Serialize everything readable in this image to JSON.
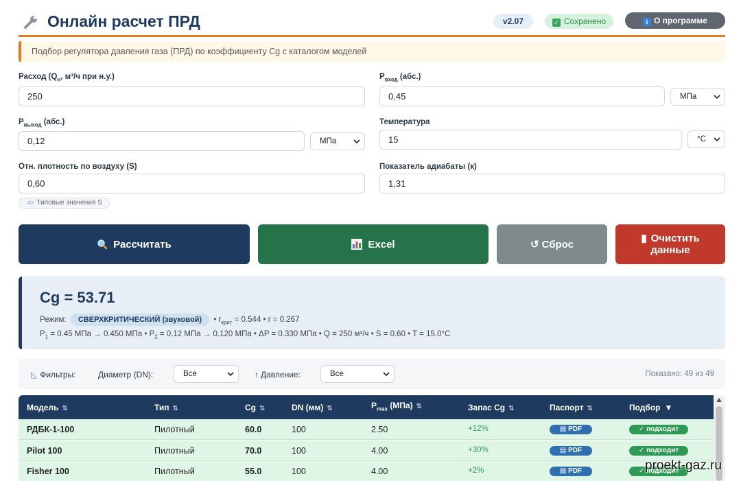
{
  "header": {
    "title": "Онлайн расчет ПРД",
    "version": "v2.07",
    "saved": "Сохранено",
    "about": "О программе"
  },
  "notice": "Подбор регулятора давления газа (ПРД) по коэффициенту Cg с каталогом моделей",
  "form": {
    "flow": {
      "label_pre": "Расход (Q",
      "label_sub": "н",
      "label_post": ", м³/ч при н.у.)",
      "value": "250"
    },
    "p_in": {
      "label_pre": "P",
      "label_sub": "вход",
      "label_post": " (абс.)",
      "value": "0,45",
      "unit": "МПа"
    },
    "p_out": {
      "label_pre": "P",
      "label_sub": "выход",
      "label_post": " (абс.)",
      "value": "0,12",
      "unit": "МПа"
    },
    "temp": {
      "label": "Температура",
      "value": "15",
      "unit": "°C"
    },
    "density": {
      "label": "Отн. плотность по воздуху (S)",
      "value": "0,60"
    },
    "adiabatic": {
      "label": "Показатель адиабаты (к)",
      "value": "1,31"
    },
    "typical_chip": "Типовые значения S"
  },
  "actions": {
    "calc": "Рассчитать",
    "excel": "Excel",
    "reset": "Сброс",
    "clear_line1": "Очистить",
    "clear_line2": "данные"
  },
  "result": {
    "cg": "Cg = 53.71",
    "mode_label": "Режим:",
    "mode_value": "СВЕРХКРИТИЧЕСКИЙ (звуковой)",
    "rcrit_pre": "• r",
    "rcrit_sub": "крит",
    "rcrit_post": " = 0.544 • r = 0.267",
    "p1_pre": "P",
    "p1_sub": "1",
    "p1_post": " = 0.45 МПа → 0.450 МПа • P",
    "p2_sub": "2",
    "p2_post": " = 0.12 МПа → 0.120 МПа • ΔP = 0.330 МПа • Q = 250 м³/ч • S = 0.60 • T = 15.0°C"
  },
  "filters": {
    "label": "Фильтры:",
    "diameter_label": "Диаметр (DN):",
    "diameter_value": "Все",
    "pressure_label": "Давление:",
    "pressure_value": "Все",
    "shown": "Показано: 49 из 49"
  },
  "table": {
    "headers": {
      "model": "Модель",
      "type": "Тип",
      "cg": "Cg",
      "dn": "DN (мм)",
      "pmax_pre": "P",
      "pmax_sub": "max",
      "pmax_post": " (МПа)",
      "reserve": "Запас Cg",
      "passport": "Паспорт",
      "select": "Подбор"
    },
    "rows": [
      {
        "model": "РДБК-1-100",
        "type": "Пилотный",
        "cg": "60.0",
        "dn": "100",
        "pmax": "2.50",
        "reserve": "+12%",
        "passport": "PDF",
        "status": "подходит"
      },
      {
        "model": "Pilot 100",
        "type": "Пилотный",
        "cg": "70.0",
        "dn": "100",
        "pmax": "4.00",
        "reserve": "+30%",
        "passport": "PDF",
        "status": "подходит"
      },
      {
        "model": "Fisher 100",
        "type": "Пилотный",
        "cg": "55.0",
        "dn": "100",
        "pmax": "4.00",
        "reserve": "+2%",
        "passport": "PDF",
        "status": "подходит"
      }
    ]
  },
  "watermark": "proekt-gaz.ru",
  "colors": {
    "primary": "#1e3a5f",
    "accent": "#e07b22",
    "excel": "#26734a",
    "reset": "#7f8a8b",
    "danger": "#c0392b",
    "ok": "#2e9a55"
  }
}
